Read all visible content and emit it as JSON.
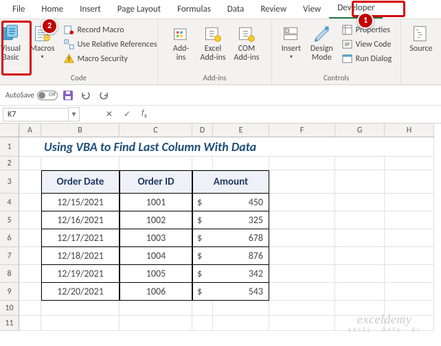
{
  "tabs": [
    "File",
    "Home",
    "Insert",
    "Page Layout",
    "Formulas",
    "Data",
    "Review",
    "View",
    "Developer"
  ],
  "activeTab": "Developer",
  "ribbon": {
    "code": {
      "vb": "Visual\nBasic",
      "macros": "Macros",
      "record": "Record Macro",
      "relref": "Use Relative References",
      "security": "Macro Security",
      "label": "Code"
    },
    "addins": {
      "addins": "Add-\nins",
      "excel": "Excel\nAdd-ins",
      "com": "COM\nAdd-ins",
      "label": "Add-ins"
    },
    "controls": {
      "insert": "Insert",
      "design": "Design\nMode",
      "props": "Properties",
      "viewcode": "View Code",
      "rundlg": "Run Dialog",
      "label": "Controls"
    },
    "xml": {
      "source": "Source"
    }
  },
  "qat": {
    "autosave_label": "AutoSave",
    "autosave_state": "Off"
  },
  "namebox": "K7",
  "formula": "",
  "cols": [
    "A",
    "B",
    "C",
    "D",
    "E",
    "F",
    "G",
    "H"
  ],
  "sheet": {
    "title": "Using VBA to Find Last Column With Data",
    "headers": [
      "Order Date",
      "Order ID",
      "Amount"
    ]
  },
  "chart_data": {
    "type": "table",
    "title": "Using VBA to Find Last Column With Data",
    "columns": [
      "Order Date",
      "Order ID",
      "Amount"
    ],
    "rows": [
      {
        "date": "12/15/2021",
        "id": "1001",
        "amount": 450
      },
      {
        "date": "12/16/2021",
        "id": "1002",
        "amount": 325
      },
      {
        "date": "12/17/2021",
        "id": "1003",
        "amount": 678
      },
      {
        "date": "12/18/2021",
        "id": "1004",
        "amount": 876
      },
      {
        "date": "12/19/2021",
        "id": "1005",
        "amount": 342
      },
      {
        "date": "12/20/2021",
        "id": "1006",
        "amount": 543
      }
    ]
  },
  "watermark": {
    "line1": "exceldemy",
    "line2": "EXCEL · DATA · BI"
  },
  "callouts": {
    "c1": "1",
    "c2": "2"
  },
  "colwidths": {
    "A": 32,
    "B": 114,
    "C": 106,
    "D": 30,
    "E": 82,
    "F": 96,
    "G": 72,
    "H": 72
  }
}
